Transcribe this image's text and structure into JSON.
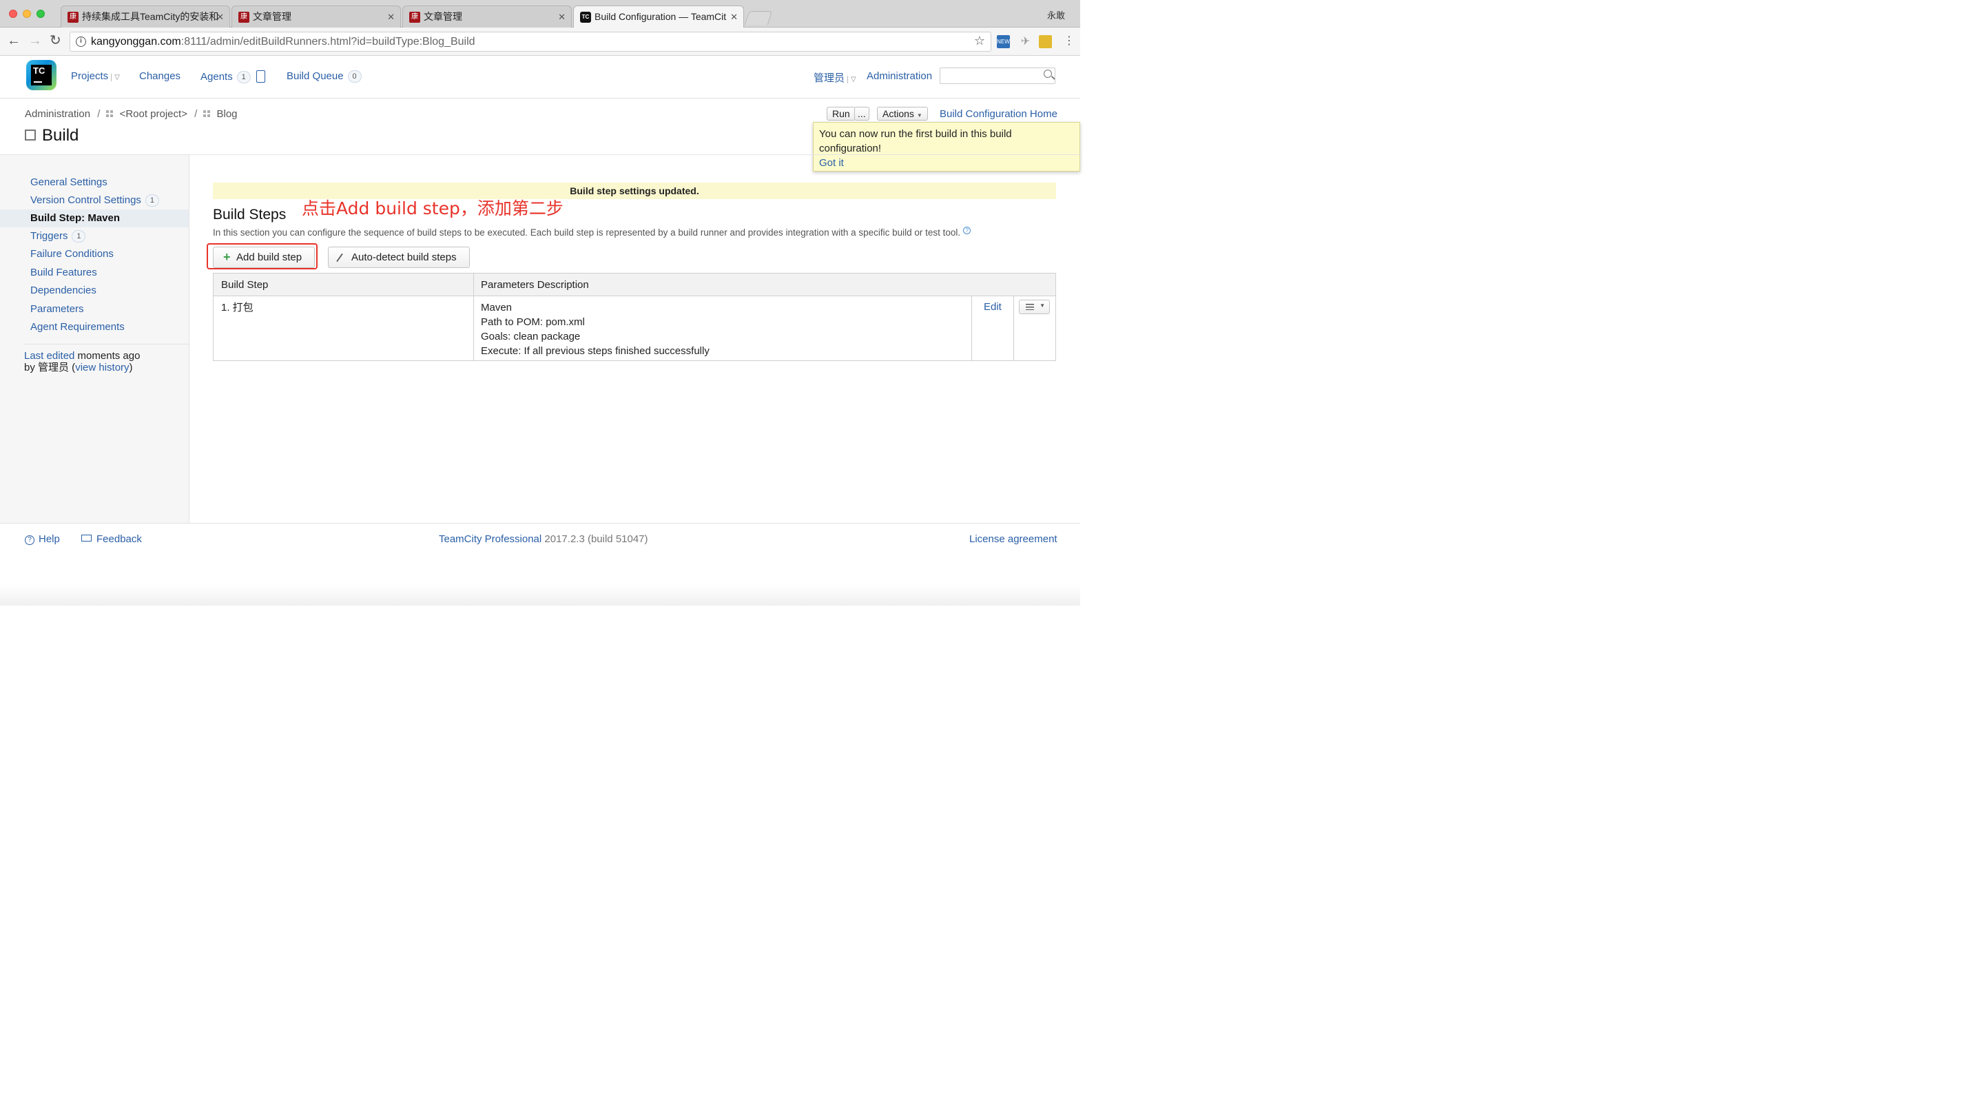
{
  "browser": {
    "tabs": [
      {
        "favicon": "康",
        "title": "持续集成工具TeamCity的安装和",
        "active": false
      },
      {
        "favicon": "康",
        "title": "文章管理",
        "active": false
      },
      {
        "favicon": "康",
        "title": "文章管理",
        "active": false
      },
      {
        "favicon": "TC",
        "title": "Build Configuration — TeamCit",
        "active": true
      }
    ],
    "user": "永敢",
    "url_host": "kangyonggan.com",
    "url_rest": ":8111/admin/editBuildRunners.html?id=buildType:Blog_Build"
  },
  "header": {
    "logo_text": "TC",
    "nav": {
      "projects": "Projects",
      "changes": "Changes",
      "agents": "Agents",
      "agents_count": "1",
      "build_queue": "Build Queue",
      "build_queue_count": "0"
    },
    "user_menu": "管理员",
    "administration": "Administration",
    "search_placeholder": ""
  },
  "breadcrumb": {
    "admin": "Administration",
    "root": "<Root project>",
    "project": "Blog"
  },
  "page_title": "Build",
  "toolbar": {
    "run": "Run",
    "run_more": "...",
    "actions": "Actions",
    "config_home": "Build Configuration Home"
  },
  "tooltip": {
    "text": "You can now run the first build in this build configuration!",
    "got_it": "Got it"
  },
  "sidebar": {
    "items": [
      {
        "label": "General Settings",
        "count": ""
      },
      {
        "label": "Version Control Settings",
        "count": "1"
      },
      {
        "label": "Build Step: Maven",
        "count": ""
      },
      {
        "label": "Triggers",
        "count": "1"
      },
      {
        "label": "Failure Conditions",
        "count": ""
      },
      {
        "label": "Build Features",
        "count": ""
      },
      {
        "label": "Dependencies",
        "count": ""
      },
      {
        "label": "Parameters",
        "count": ""
      },
      {
        "label": "Agent Requirements",
        "count": ""
      }
    ],
    "last_edited_link": "Last edited",
    "last_edited_rest": " moments ago",
    "by": "by 管理员  (",
    "view_history": "view history",
    "close_paren": ")"
  },
  "main": {
    "notice": "Build step settings updated.",
    "annotation": "点击Add build step，添加第二步",
    "heading": "Build Steps",
    "description": "In this section you can configure the sequence of build steps to be executed. Each build step is represented by a build runner and provides integration with a specific build or test tool.",
    "help_icon": "?",
    "add_step": "Add build step",
    "auto_detect": "Auto-detect build steps",
    "table": {
      "headers": [
        "Build Step",
        "Parameters Description"
      ],
      "rows": [
        {
          "step": "1. 打包",
          "params": [
            "Maven",
            "Path to POM: pom.xml",
            "Goals: clean package",
            "Execute: If all previous steps finished successfully"
          ],
          "edit": "Edit"
        }
      ]
    }
  },
  "footer": {
    "help": "Help",
    "feedback": "Feedback",
    "product": "TeamCity Professional",
    "version": " 2017.2.3 (build 51047)",
    "license": "License agreement"
  }
}
